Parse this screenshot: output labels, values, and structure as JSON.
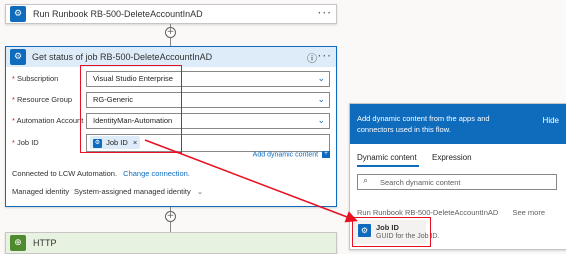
{
  "top_step": {
    "title": "Run Runbook RB-500-DeleteAccountInAD",
    "menu": "···"
  },
  "action": {
    "title": "Get status of job RB-500-DeleteAccountInAD",
    "info": "ⓘ",
    "menu": "···",
    "fields": {
      "subscription": {
        "label": "Subscription",
        "value": "Visual Studio Enterprise"
      },
      "resource_group": {
        "label": "Resource Group",
        "value": "RG-Generic"
      },
      "automation_account": {
        "label": "Automation Account",
        "value": "IdentityMan-Automation"
      },
      "job_id": {
        "label": "Job ID",
        "token": "Job ID",
        "token_close": "×"
      }
    },
    "add_dynamic": "Add dynamic content",
    "connected_text": "Connected to LCW Automation.",
    "change_connection": "Change connection.",
    "managed_identity_label": "Managed identity",
    "managed_identity_value": "System-assigned managed identity"
  },
  "http_step": {
    "title": "HTTP"
  },
  "dynamic_panel": {
    "header_text": "Add dynamic content from the apps and connectors used in this flow.",
    "hide": "Hide",
    "tabs": [
      "Dynamic content",
      "Expression"
    ],
    "search_placeholder": "Search dynamic content",
    "section_title": "Run Runbook RB-500-DeleteAccountInAD",
    "see_more": "See more",
    "item": {
      "title": "Job ID",
      "desc": "GUID for the Job ID."
    }
  },
  "colors": {
    "accent": "#0f6cbd",
    "annotation": "#e81123"
  }
}
